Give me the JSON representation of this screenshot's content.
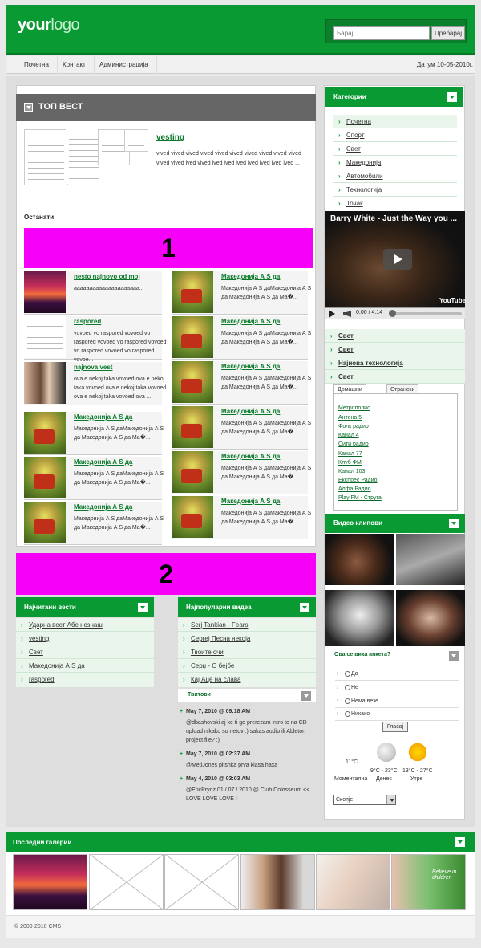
{
  "header": {
    "logo_bold": "your",
    "logo_light": "logo",
    "search_placeholder": "Барај...",
    "search_button": "Пребарај"
  },
  "nav": {
    "items": [
      "Почетна",
      "Контакт",
      "Администрација"
    ],
    "date": "Датум 10-05-2010г."
  },
  "top_news": {
    "heading": "ТОП ВЕСТ",
    "article_title": "vesting",
    "article_text": "vived vived vived vived vived vived vived vived vived vived vived vived ived vived ived ived ived ived ived ived ived ...",
    "others_label": "Останати"
  },
  "banner1": "1",
  "banner2": "2",
  "left_list": [
    {
      "title": "nesto najnovo od moj",
      "text": "aaaaaaaaaaaaaaaaaaaaa..."
    },
    {
      "title": "raspored",
      "text": "vovoed vo raspored vovoed vo raspored vovoed vo raspored vovoed vo raspored vovoed vo raspored vovoe..."
    },
    {
      "title": "najnova vest",
      "text": "ova e nekoj taka vovoed ova e nekoj taka vovoed ova e nekoj taka vovoed ova e nekoj taka vovoed ova ..."
    },
    {
      "title": "Македонија А S да",
      "text": "Македонија А S даМакедонија А S да Македонија А S да Ма�..."
    },
    {
      "title": "Македонија А S да",
      "text": "Македонија А S даМакедонија А S да Македонија А S да Ма�..."
    },
    {
      "title": "Македонија А S да",
      "text": "Македонија А S даМакедонија А S да Македонија А S да Ма�..."
    }
  ],
  "right_list": [
    {
      "title": "Македонија А S да",
      "text": "Македонија А S даМакедонија А S да Македонија А S да Ма�..."
    },
    {
      "title": "Македонија А S да",
      "text": "Македонија А S даМакедонија А S да Македонија А S да Ма�..."
    },
    {
      "title": "Македонија А S да",
      "text": "Македонија А S даМакедонија А S да Македонија А S да Ма�..."
    },
    {
      "title": "Македонија А S да",
      "text": "Македонија А S даМакедонија А S да Македонија А S да Ма�..."
    },
    {
      "title": "Македонија А S да",
      "text": "Македонија А S даМакедонија А S да Македонија А S да Ма�..."
    },
    {
      "title": "Македонија А S да",
      "text": "Македонија А S даМакедонија А S да Македонија А S да Ма�..."
    }
  ],
  "most_read": {
    "heading": "Најчитани вести",
    "items": [
      "Ударна вест Абе незнаш",
      "vesting",
      "Свет",
      "Македонија А S да",
      "raspored"
    ]
  },
  "popular_videos": {
    "heading": "Најпопуларни видеа",
    "items": [
      "Serj Tankian - Fears",
      "Сергеј Песна некоја",
      "Твоите очи",
      "Серџ - О бејбе",
      "Кај Аце на слава"
    ]
  },
  "tweets": {
    "heading": "Твитови",
    "items": [
      {
        "date": "May 7, 2010 @ 09:18 AM",
        "text": "@dbashovski aj ke ti go prerezam intro to na CD upload nikako so netov :) sakas audio ili Ableton project file? :)"
      },
      {
        "date": "May 7, 2010 @ 02:37 AM",
        "text": "@MetiJones pitshka prva klasa haxa"
      },
      {
        "date": "May 4, 2010 @ 03:03 AM",
        "text": "@EricPrydz 01 / 07 / 2010 @ Club Colosseum << LOVE LOVE LOVE !"
      }
    ]
  },
  "categories": {
    "heading": "Категории",
    "items": [
      "Почетна",
      "Спорт",
      "Свет",
      "Македонија",
      "Автомобили",
      "Технологија",
      "Точак"
    ]
  },
  "video_player": {
    "title": "Barry White - Just the Way you ...",
    "time": "0:00 / 4:14",
    "brand": "YouTube"
  },
  "side_links": [
    "Свет",
    "Свет",
    "Најнова технологија",
    "Свет"
  ],
  "radio": {
    "tabs": [
      "Домашни радиа",
      "Странски радиа"
    ],
    "stations": [
      "Метрополис",
      "Антена 5",
      "Фолк радио",
      "Канал 4",
      "Сити радио",
      "Канал 77",
      "Клуб ФМ",
      "Канал 103",
      "Експрес Радио",
      "Алфа Радио",
      "Play FM - Струга"
    ]
  },
  "video_clips": {
    "heading": "Видео клипови"
  },
  "poll": {
    "question": "Ова се вика анкета?",
    "options": [
      "Да",
      "Не",
      "Нема везе",
      "Никако"
    ],
    "vote_button": "Гласај"
  },
  "weather": {
    "current_temp": "11°C",
    "today_range": "9°C - 23°C",
    "tomorrow_range": "13°C - 27°C",
    "labels": [
      "Моментална",
      "Денес",
      "Утре"
    ],
    "city": "Скопје"
  },
  "galleries": {
    "heading": "Последни галерии",
    "overlay_text": "Believe in children"
  },
  "footer": {
    "copyright": "© 2009-2010 CMS"
  },
  "colors": {
    "brand_green": "#0a9a34",
    "banner_magenta": "#f700f7"
  }
}
